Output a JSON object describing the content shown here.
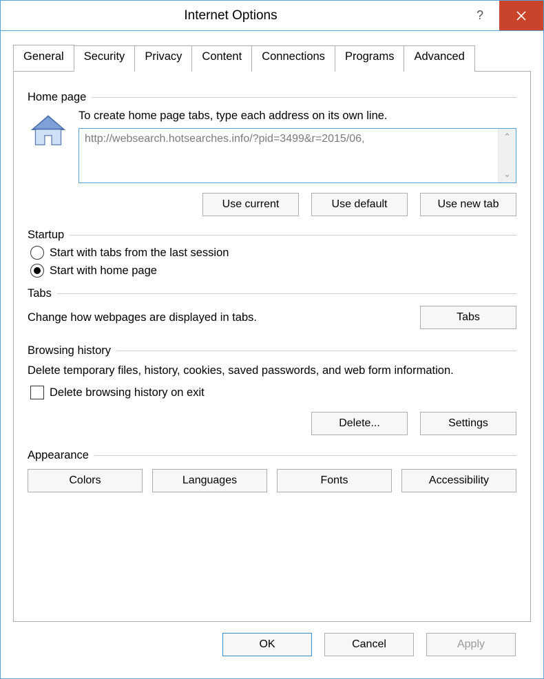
{
  "window": {
    "title": "Internet Options"
  },
  "tabs": [
    "General",
    "Security",
    "Privacy",
    "Content",
    "Connections",
    "Programs",
    "Advanced"
  ],
  "active_tab": 0,
  "homepage": {
    "label": "Home page",
    "desc": "To create home page tabs, type each address on its own line.",
    "url": "http://websearch.hotsearches.info/?pid=3499&r=2015/06,",
    "use_current": "Use current",
    "use_default": "Use default",
    "use_new_tab": "Use new tab"
  },
  "startup": {
    "label": "Startup",
    "opt_last": "Start with tabs from the last session",
    "opt_home": "Start with home page",
    "selected": "home"
  },
  "tabs_section": {
    "label": "Tabs",
    "desc": "Change how webpages are displayed in tabs.",
    "button": "Tabs"
  },
  "history": {
    "label": "Browsing history",
    "desc": "Delete temporary files, history, cookies, saved passwords, and web form information.",
    "checkbox": "Delete browsing history on exit",
    "delete": "Delete...",
    "settings": "Settings"
  },
  "appearance": {
    "label": "Appearance",
    "colors": "Colors",
    "languages": "Languages",
    "fonts": "Fonts",
    "accessibility": "Accessibility"
  },
  "footer": {
    "ok": "OK",
    "cancel": "Cancel",
    "apply": "Apply"
  }
}
